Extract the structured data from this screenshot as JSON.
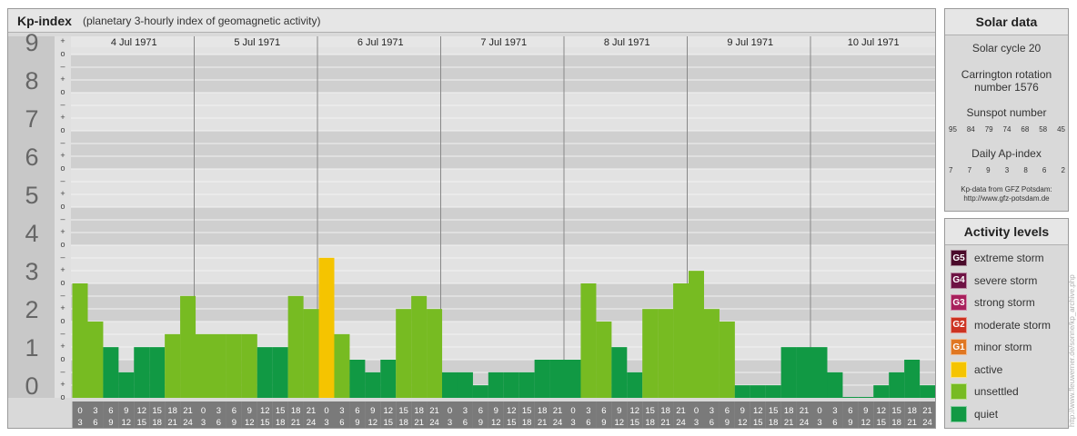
{
  "header": {
    "title": "Kp-index",
    "subtitle": "(planetary 3-hourly index of geomagnetic activity)"
  },
  "solar": {
    "title": "Solar data",
    "cycle": "Solar cycle 20",
    "carrington": "Carrington rotation number 1576",
    "sunspot_label": "Sunspot number",
    "sunspot_values": [
      "95",
      "84",
      "79",
      "74",
      "68",
      "58",
      "45"
    ],
    "ap_label": "Daily Ap-index",
    "ap_values": [
      "7",
      "7",
      "9",
      "3",
      "8",
      "6",
      "2"
    ],
    "source": "Kp-data from GFZ Potsdam:",
    "source_url": "http://www.gfz-potsdam.de"
  },
  "activity": {
    "title": "Activity levels",
    "items": [
      {
        "code": "G5",
        "label": "extreme storm",
        "color": "#4a0a2a"
      },
      {
        "code": "G4",
        "label": "severe storm",
        "color": "#6e1244"
      },
      {
        "code": "G3",
        "label": "strong storm",
        "color": "#a8205c"
      },
      {
        "code": "G2",
        "label": "moderate storm",
        "color": "#cc3322"
      },
      {
        "code": "G1",
        "label": "minor storm",
        "color": "#e07722"
      },
      {
        "code": "",
        "label": "active",
        "color": "#f5c400"
      },
      {
        "code": "",
        "label": "unsettled",
        "color": "#77bb22"
      },
      {
        "code": "",
        "label": "quiet",
        "color": "#119944"
      }
    ]
  },
  "watermark": "http://www.fleuwerner.de/sonne/kp_archive.php",
  "chart_data": {
    "type": "bar",
    "y_tick_labels": [
      "0",
      "1",
      "2",
      "3",
      "4",
      "5",
      "6",
      "7",
      "8",
      "9"
    ],
    "minor_tick_labels": [
      "o",
      "+",
      "–"
    ],
    "ylim": [
      0,
      9.33
    ],
    "days": [
      "4 Jul 1971",
      "5 Jul 1971",
      "6 Jul 1971",
      "7 Jul 1971",
      "8 Jul 1971",
      "9 Jul 1971",
      "10 Jul 1971"
    ],
    "interval_labels": [
      [
        "0",
        "3"
      ],
      [
        "3",
        "6"
      ],
      [
        "6",
        "9"
      ],
      [
        "9",
        "12"
      ],
      [
        "12",
        "15"
      ],
      [
        "15",
        "18"
      ],
      [
        "18",
        "21"
      ],
      [
        "21",
        "24"
      ]
    ],
    "values": [
      3.0,
      2.0,
      1.33,
      0.67,
      1.33,
      1.33,
      1.67,
      2.67,
      1.67,
      1.67,
      1.67,
      1.67,
      1.33,
      1.33,
      2.67,
      2.33,
      3.67,
      1.67,
      1.0,
      0.67,
      1.0,
      2.33,
      2.67,
      2.33,
      0.67,
      0.67,
      0.33,
      0.67,
      0.67,
      0.67,
      1.0,
      1.0,
      1.0,
      3.0,
      2.0,
      1.33,
      0.67,
      2.33,
      2.33,
      3.0,
      3.33,
      2.33,
      2.0,
      0.33,
      0.33,
      0.33,
      1.33,
      1.33,
      1.33,
      0.67,
      0.0,
      0.0,
      0.33,
      0.67,
      1.0,
      0.33
    ],
    "colors": {
      "quiet": "#119944",
      "unsettled": "#77bb22",
      "active": "#f5c400"
    }
  }
}
